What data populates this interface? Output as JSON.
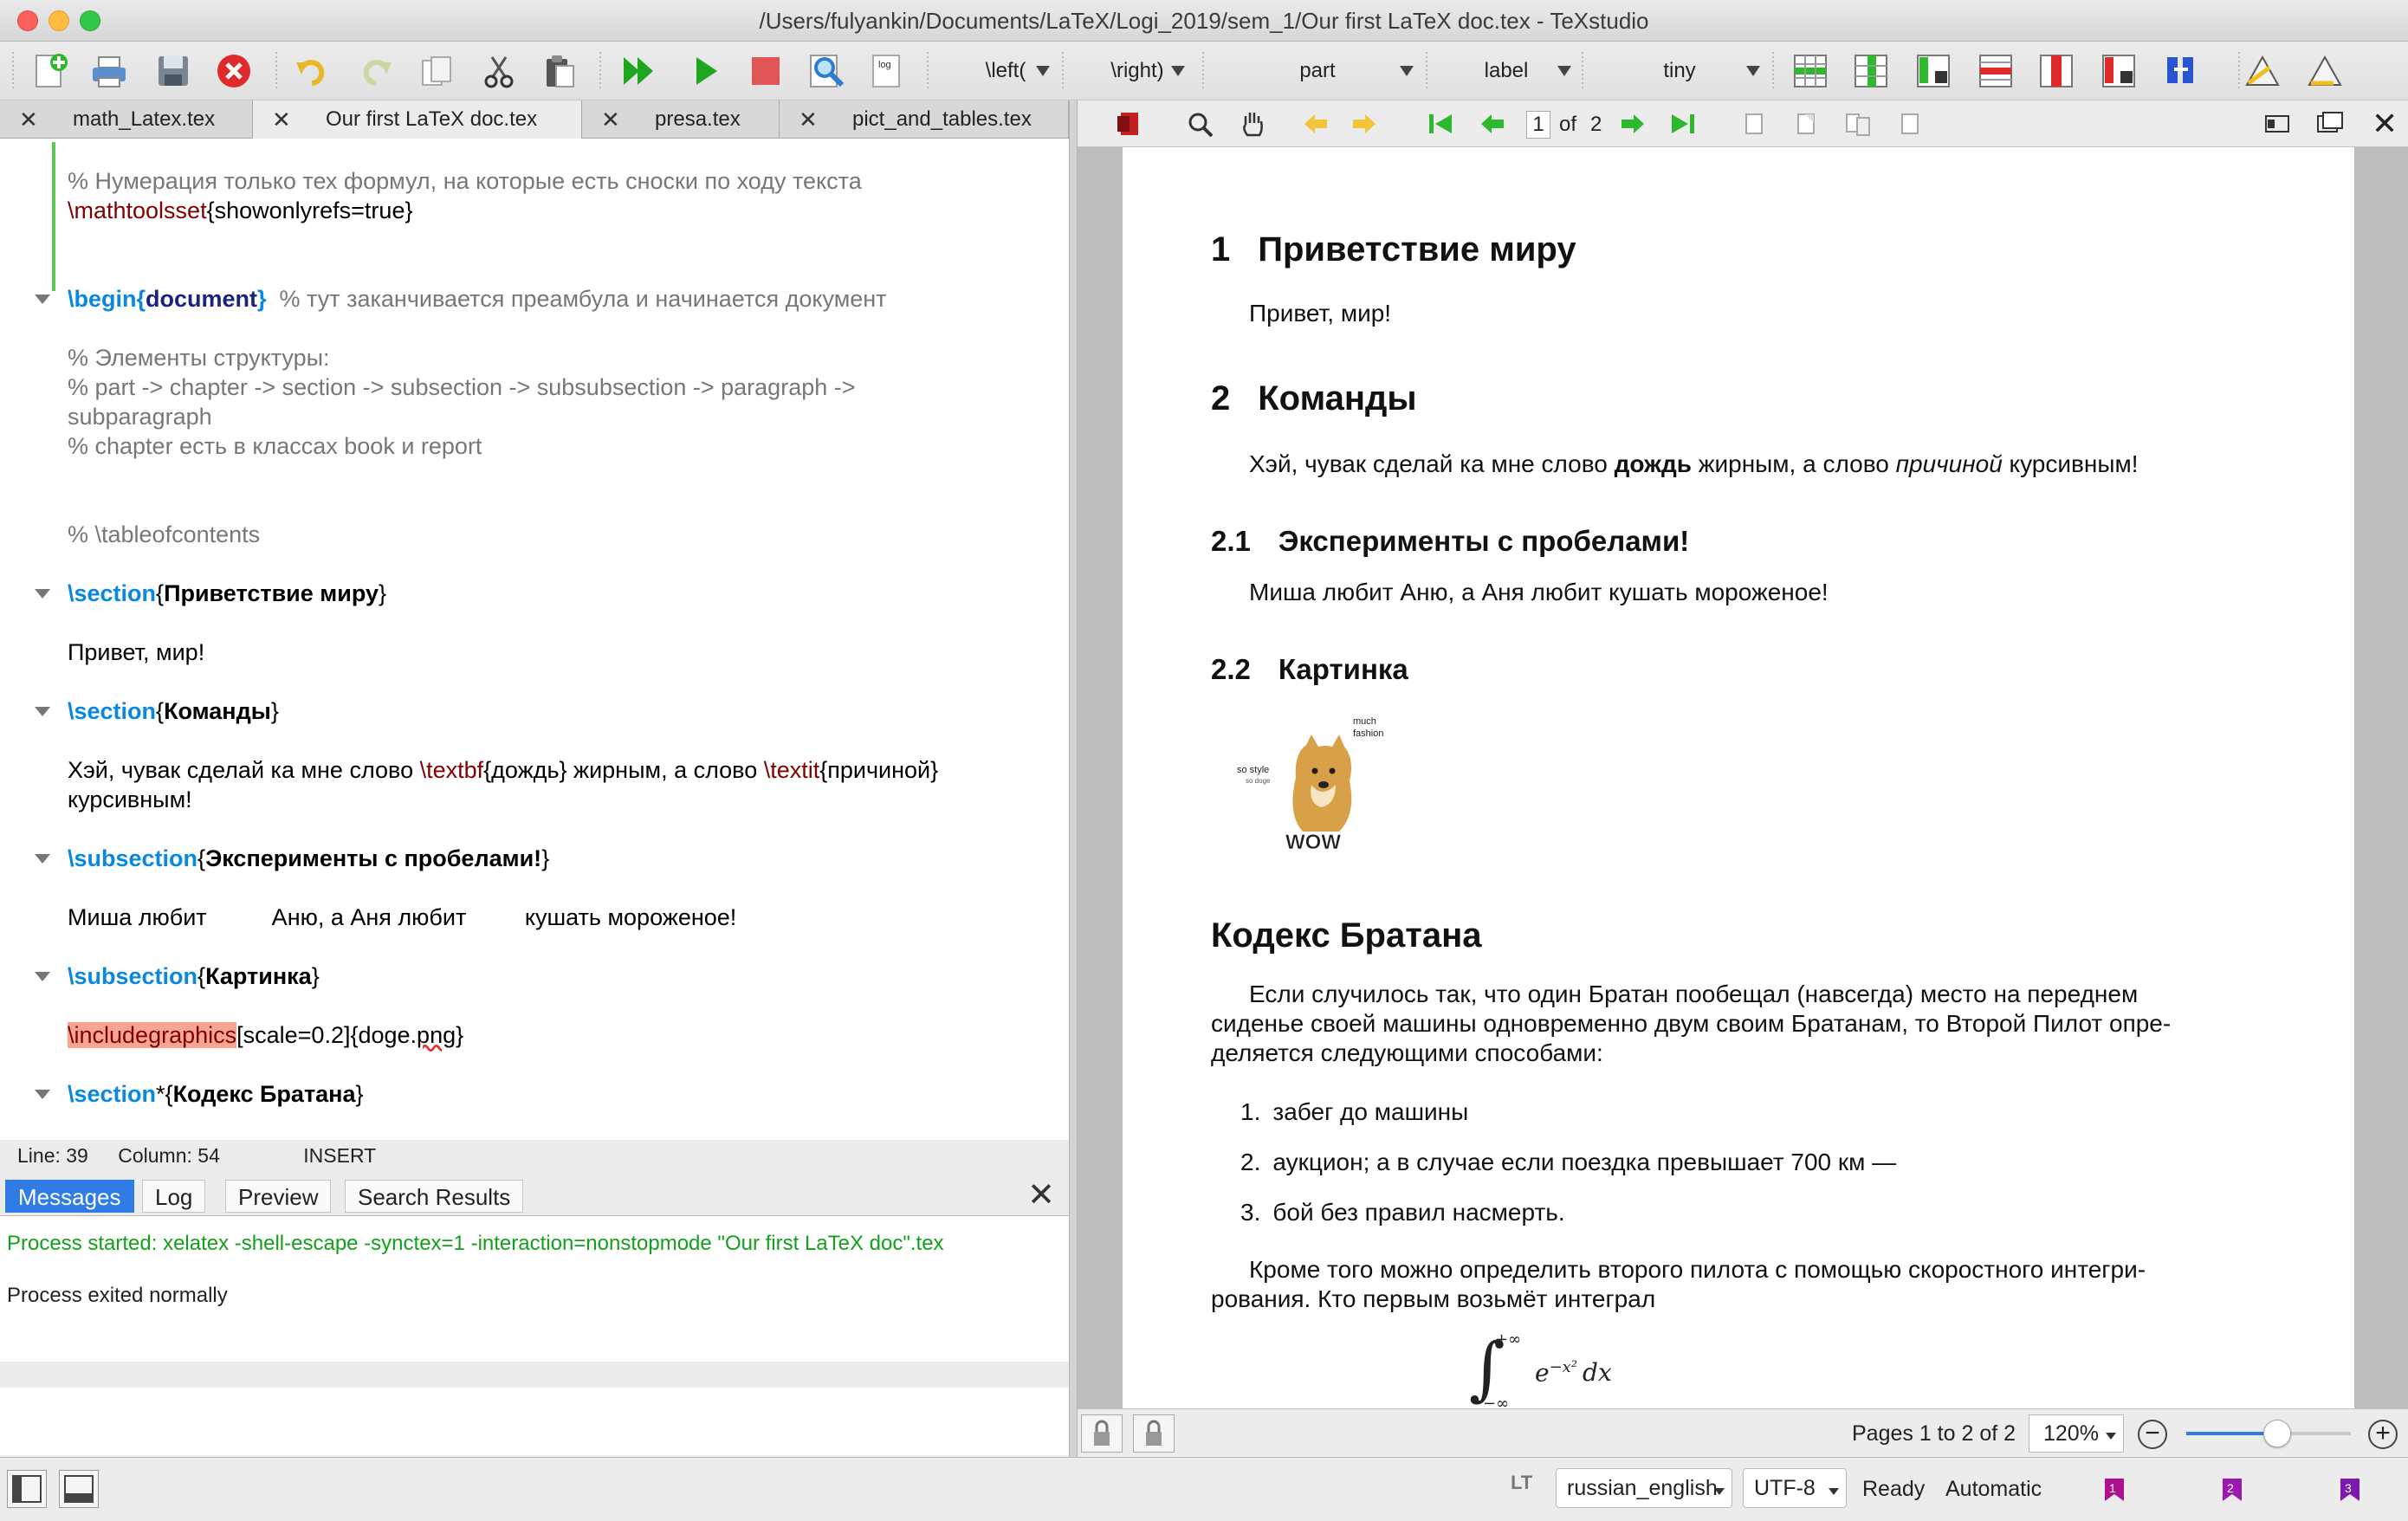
{
  "window": {
    "title": "/Users/fulyankin/Documents/LaTeX/Logi_2019/sem_1/Our first LaTeX doc.tex - TeXstudio"
  },
  "toolbar": {
    "combos": [
      "\\left(",
      "\\right)",
      "part",
      "label",
      "tiny"
    ]
  },
  "editor_tabs": [
    {
      "label": "math_Latex.tex"
    },
    {
      "label": "Our first LaTeX doc.tex"
    },
    {
      "label": "presa.tex"
    },
    {
      "label": "pict_and_tables.tex"
    }
  ],
  "editor": {
    "l1": "% Нумерация только тех формул, на которые есть сноски по ходу текста",
    "l2_cmd": "\\mathtoolsset",
    "l2_arg": "{showonlyrefs=true}",
    "l3_cmd": "\\begin",
    "l3_brace_open": "{",
    "l3_env": "document",
    "l3_brace_close": "}",
    "l3_comment": "  % тут заканчивается преамбула и начинается документ",
    "l4": "% Элементы структуры:",
    "l5": "% part -> chapter -> section -> subsection -> subsubsection -> paragraph ->",
    "l6": "subparagraph",
    "l7": "% chapter есть в классах book и report",
    "l8": "% \\tableofcontents",
    "l9_cmd": "\\section",
    "l9_arg": "Приветствие миру",
    "l10": "Привет, мир!",
    "l11_cmd": "\\section",
    "l11_arg": "Команды",
    "l12_a": "Хэй, чувак сделай ка мне слово ",
    "l12_bf": "\\textbf",
    "l12_b": "{дождь} жирным, а слово ",
    "l12_it": "\\textit",
    "l12_c": "{причиной}",
    "l13": "курсивным!",
    "l14_cmd": "\\subsection",
    "l14_arg": "Эксперименты с пробелами!",
    "l15": "Миша любит          Аню, а Аня любит         кушать мороженое!",
    "l16_cmd": "\\subsection",
    "l16_arg": "Картинка",
    "l17_cmd": "\\includegraphics",
    "l17_a": "[scale=0.2]{doge.",
    "l17_b": "png",
    "l17_c": "}",
    "l18_cmd": "\\section",
    "l18_star": "*",
    "l18_arg": "Кодекс Братана"
  },
  "status": {
    "line": "Line: 39",
    "column": "Column: 54",
    "mode": "INSERT"
  },
  "messages": {
    "tabs": [
      "Messages",
      "Log",
      "Preview",
      "Search Results"
    ],
    "started": "Process started: xelatex -shell-escape -synctex=1 -interaction=nonstopmode \"Our first LaTeX doc\".tex",
    "exited": "Process exited normally"
  },
  "pdf_toolbar": {
    "page": "1",
    "of": "of",
    "total": "2"
  },
  "pdf": {
    "s1_num": "1",
    "s1_title": "Приветствие миру",
    "s1_body": "Привет, мир!",
    "s2_num": "2",
    "s2_title": "Команды",
    "s2_body_a": "Хэй, чувак сделай ка мне слово ",
    "s2_body_bold": "дождь",
    "s2_body_b": " жирным, а слово ",
    "s2_body_it": "причиной",
    "s2_body_c": " курсивным!",
    "s21_num": "2.1",
    "s21_title": "Эксперименты с пробелами!",
    "s21_body": "Миша любит Аню, а Аня любит кушать мороженое!",
    "s22_num": "2.2",
    "s22_title": "Картинка",
    "doge_much": "much",
    "doge_fashion": "fashion",
    "doge_so_style": "so style",
    "doge_so_doge": "so doge",
    "doge_wow": "WOW",
    "s3_title": "Кодекс Братана",
    "p1_l1": "Если случилось так, что один Братан пообещал (навсегда) место на переднем",
    "p1_l2": "сиденье своей машины одновременно двум своим Братанам, то Второй Пилот опре-",
    "p1_l3": "деляется следующими способами:",
    "list": [
      {
        "n": "1.",
        "t": "забег до машины"
      },
      {
        "n": "2.",
        "t": "аукцион; а в случае если поездка превышает 700 км —"
      },
      {
        "n": "3.",
        "t": "бой без правил насмерть."
      }
    ],
    "p2_l1": "Кроме того можно определить второго пилота с помощью скоростного интегри-",
    "p2_l2": "рования. Кто первым возьмёт интеграл",
    "int_upper": "+∞",
    "int_lower": "−∞",
    "int_expr": "e",
    "int_exp": "−x²",
    "int_dx": "dx"
  },
  "pdf_bottom": {
    "pages": "Pages 1 to 2 of 2",
    "zoom": "120%",
    "slider_fraction": 0.55
  },
  "statusbar": {
    "language": "russian_english",
    "encoding": "UTF-8",
    "ready": "Ready",
    "mode": "Automatic",
    "lt_label": "LT"
  }
}
